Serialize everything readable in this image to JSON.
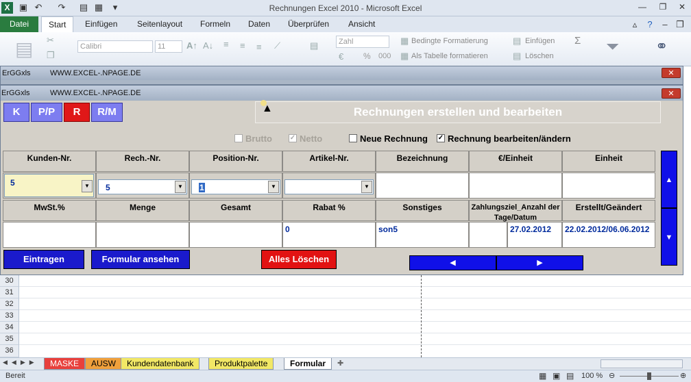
{
  "app": {
    "title": "Rechnungen Excel 2010  -  Microsoft Excel"
  },
  "ribbon": {
    "tabs": [
      "Datei",
      "Start",
      "Einfügen",
      "Seitenlayout",
      "Formeln",
      "Daten",
      "Überprüfen",
      "Ansicht"
    ],
    "font_name": "Calibri",
    "font_size": "11",
    "number_format": "Zahl",
    "percent": "%",
    "thousands": "000",
    "cond_format": "Bedingte Formatierung",
    "as_table": "Als Tabelle formatieren",
    "insert": "Einfügen",
    "delete": "Löschen",
    "sigma": "Σ"
  },
  "back_window": {
    "caption_left": "ErGGxls",
    "caption_url": "WWW.EXCEL-.NPAGE.DE"
  },
  "form": {
    "caption_left": "ErGGxls",
    "caption_url": "WWW.EXCEL-.NPAGE.DE",
    "nav_buttons": [
      "K",
      "P/P",
      "R",
      "R/M"
    ],
    "banner": "Rechnungen erstellen und bearbeiten",
    "checks": {
      "brutto": "Brutto",
      "netto": "Netto",
      "neue": "Neue Rechnung",
      "bearbeiten": "Rechnung bearbeiten/ändern"
    },
    "headers1": [
      "Kunden-Nr.",
      "Rech.-Nr.",
      "Position-Nr.",
      "Artikel-Nr.",
      "Bezeichnung",
      "€/Einheit",
      "Einheit"
    ],
    "values1": {
      "kunden": "5",
      "rech": "5",
      "position": "1",
      "artikel": ""
    },
    "headers2": [
      "MwSt.%",
      "Menge",
      "Gesamt",
      "Rabat %",
      "Sonstiges",
      "Zahlungsziel_Anzahl der Tage/Datum",
      "Erstellt/Geändert"
    ],
    "values2": {
      "rabat": "0",
      "sonstiges": "son5",
      "zahlungsziel": "27.02.2012",
      "erstellt": "22.02.2012/06.06.2012"
    },
    "buttons": {
      "eintragen": "Eintragen",
      "ansehen": "Formular ansehen",
      "loeschen": "Alles Löschen",
      "prev": "◀",
      "next": "▶",
      "up": "▲",
      "down": "▼"
    }
  },
  "grid": {
    "rows": [
      "30",
      "31",
      "32",
      "33",
      "34",
      "35",
      "36"
    ]
  },
  "sheet_tabs": [
    "MASKE",
    "AUSW",
    "Kundendatenbank",
    "Produktpalette",
    "Formular"
  ],
  "status": {
    "ready": "Bereit",
    "zoom": "100 %"
  },
  "colors": {
    "excel_green": "#1e7145",
    "button_blue": "#1a1acc",
    "button_red": "#e21212",
    "nav_purple": "#7d7df0"
  }
}
